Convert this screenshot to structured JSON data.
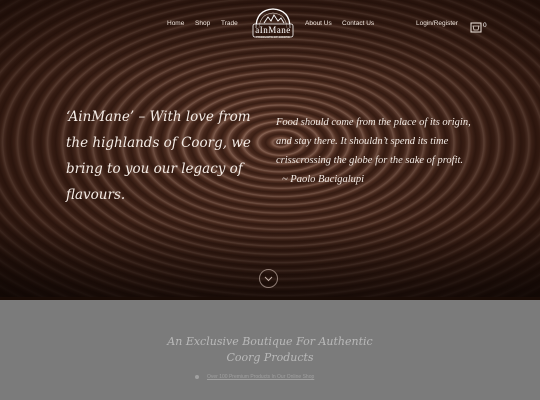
{
  "nav": {
    "home": "Home",
    "shop": "Shop",
    "trade": "Trade",
    "about": "About Us",
    "contact": "Contact Us",
    "login": "Login/Register",
    "cart_count": "0"
  },
  "logo": {
    "text": "aInMane",
    "subtext": "PRODUCTS OF COORG"
  },
  "hero": {
    "tagline_lines": [
      "‘AinMane’ – With love from",
      "the highlands of Coorg, we",
      "bring to you our legacy of",
      "flavours."
    ],
    "quote_lines": [
      "Food should come from the place of its origin,",
      "and stay there. It shouldn’t spend its time",
      "crisscrossing the globe for the sake of profit.",
      "~ Paolo Bacigalupi"
    ]
  },
  "boutique": {
    "title_line1": "An Exclusive Boutique For Authentic",
    "title_line2": "Coorg Products",
    "sub": "Over 100 Premium Products In Our Online Shop"
  },
  "colors": {
    "chocolate": "#4a2a1e",
    "grey_band": "#7b7b7b",
    "nav_text": "#f2e8e0"
  },
  "icons": [
    "cart-icon",
    "chevron-down-icon",
    "dot-icon"
  ]
}
